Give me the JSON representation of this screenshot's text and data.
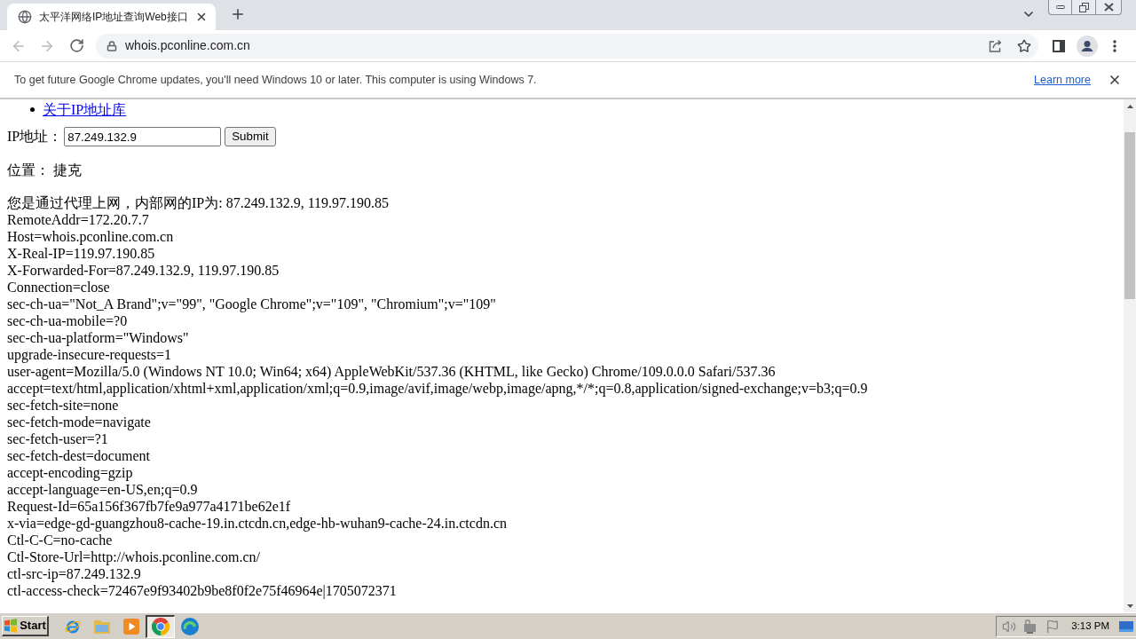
{
  "browser": {
    "tabs": [
      {
        "title": "太平洋网络IP地址查询Web接口",
        "selected": true
      }
    ],
    "address": "whois.pconline.com.cn"
  },
  "infobar": {
    "message": "To get future Google Chrome updates, you'll need Windows 10 or later. This computer is using Windows 7.",
    "link": "Learn more"
  },
  "page": {
    "nav_links": [
      "关于IP地址库"
    ],
    "ip_form": {
      "label": "IP地址：",
      "value": "87.249.132.9",
      "submit": "Submit"
    },
    "location": "位置： 捷克",
    "lines": [
      "您是通过代理上网，内部网的IP为: 87.249.132.9, 119.97.190.85",
      "RemoteAddr=172.20.7.7",
      "Host=whois.pconline.com.cn",
      "X-Real-IP=119.97.190.85",
      "X-Forwarded-For=87.249.132.9, 119.97.190.85",
      "Connection=close",
      "sec-ch-ua=\"Not_A Brand\";v=\"99\", \"Google Chrome\";v=\"109\", \"Chromium\";v=\"109\"",
      "sec-ch-ua-mobile=?0",
      "sec-ch-ua-platform=\"Windows\"",
      "upgrade-insecure-requests=1",
      "user-agent=Mozilla/5.0 (Windows NT 10.0; Win64; x64) AppleWebKit/537.36 (KHTML, like Gecko) Chrome/109.0.0.0 Safari/537.36",
      "accept=text/html,application/xhtml+xml,application/xml;q=0.9,image/avif,image/webp,image/apng,*/*;q=0.8,application/signed-exchange;v=b3;q=0.9",
      "sec-fetch-site=none",
      "sec-fetch-mode=navigate",
      "sec-fetch-user=?1",
      "sec-fetch-dest=document",
      "accept-encoding=gzip",
      "accept-language=en-US,en;q=0.9",
      "Request-Id=65a156f367fb7fe9a977a4171be62e1f",
      "x-via=edge-gd-guangzhou8-cache-19.in.ctcdn.cn,edge-hb-wuhan9-cache-24.in.ctcdn.cn",
      "Ctl-C-C=no-cache",
      "Ctl-Store-Url=http://whois.pconline.com.cn/",
      "ctl-src-ip=87.249.132.9",
      "ctl-access-check=72467e9f93402b9be8f0f2e75f46964e|1705072371"
    ]
  },
  "taskbar": {
    "start": "Start",
    "apps": [
      {
        "kind": "ie",
        "selected": false
      },
      {
        "kind": "explorer",
        "selected": false
      },
      {
        "kind": "media",
        "selected": false
      },
      {
        "kind": "chrome",
        "selected": true
      },
      {
        "kind": "edge",
        "selected": false
      }
    ],
    "clock": "3:13 PM"
  }
}
